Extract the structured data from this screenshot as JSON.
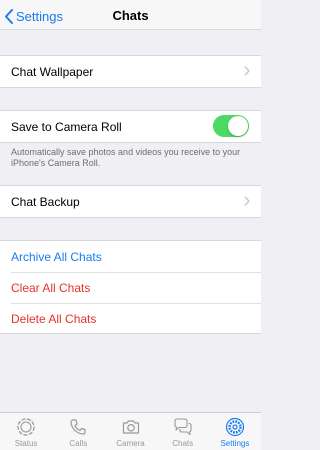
{
  "nav": {
    "back_label": "Settings",
    "title": "Chats"
  },
  "settings": {
    "wallpaper_label": "Chat Wallpaper",
    "camera_roll_label": "Save to Camera Roll",
    "camera_roll_on": true,
    "camera_roll_footer": "Automatically save photos and videos you receive to your iPhone's Camera Roll.",
    "backup_label": "Chat Backup"
  },
  "actions": {
    "archive_label": "Archive All Chats",
    "clear_label": "Clear All Chats",
    "delete_label": "Delete All Chats"
  },
  "colors": {
    "accent": "#1a7cf0",
    "destructive": "#e5322d",
    "toggle_on": "#4cd964"
  },
  "tabs": [
    {
      "label": "Status",
      "icon": "status-icon"
    },
    {
      "label": "Calls",
      "icon": "phone-icon"
    },
    {
      "label": "Camera",
      "icon": "camera-icon"
    },
    {
      "label": "Chats",
      "icon": "chat-bubbles-icon"
    },
    {
      "label": "Settings",
      "icon": "gear-icon",
      "active": true
    }
  ]
}
